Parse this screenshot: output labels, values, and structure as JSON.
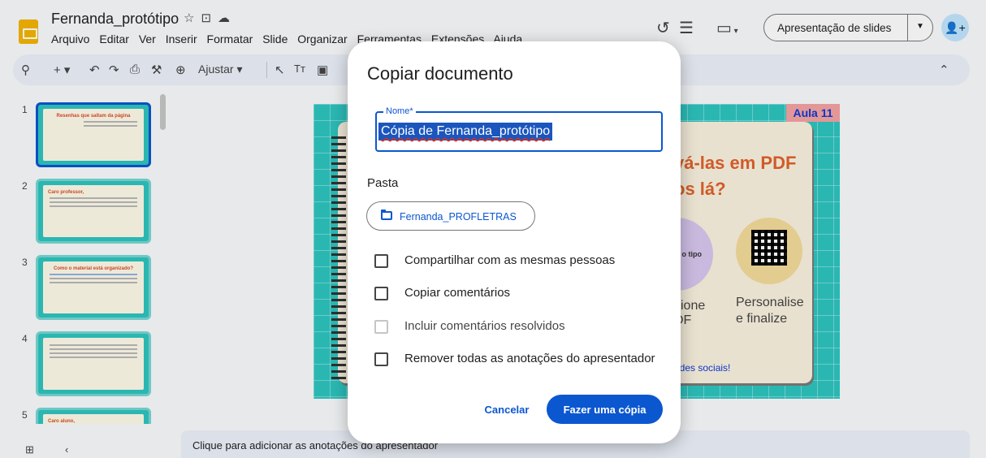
{
  "app": {
    "doc_title": "Fernanda_protótipo",
    "title_icons": [
      "star-icon",
      "move-to-folder-icon",
      "cloud-saved-icon"
    ],
    "menu": [
      "Arquivo",
      "Editar",
      "Ver",
      "Inserir",
      "Formatar",
      "Slide",
      "Organizar",
      "Ferramentas",
      "Extensões",
      "Ajuda"
    ],
    "present_label": "Apresentação de slides",
    "header_icons": [
      "history-icon",
      "comments-icon",
      "meet-icon",
      "share-icon"
    ]
  },
  "toolbar": {
    "zoom_label": "Ajustar",
    "icons": [
      "search-icon",
      "new-slide-icon",
      "undo-icon",
      "redo-icon",
      "print-icon",
      "paint-format-icon",
      "zoom-icon",
      "select-icon",
      "textbox-icon",
      "image-icon",
      "collapse-icon"
    ]
  },
  "thumbnails": [
    {
      "num": "1",
      "title": "Resenhas que saltam da página"
    },
    {
      "num": "2",
      "title": "Caro professor,"
    },
    {
      "num": "3",
      "title": "Como o material está organizado?"
    },
    {
      "num": "4",
      "title": ""
    },
    {
      "num": "5",
      "title": "Caro aluno,"
    }
  ],
  "slide": {
    "badge": "Aula 11",
    "heading1": "vá-las em PDF",
    "heading2": "os lá?",
    "circle_label": "a o tipo",
    "text_left1": "cione",
    "text_left2": "DF",
    "text_right1": "Personalise",
    "text_right2": "e finalize",
    "link_text": "edes sociais!"
  },
  "notes_placeholder": "Clique para adicionar as anotações do apresentador",
  "dialog": {
    "title": "Copiar documento",
    "name_label": "Nome*",
    "name_value": "Cópia de Fernanda_protótipo",
    "folder_label": "Pasta",
    "folder_name": "Fernanda_PROFLETRAS",
    "options": [
      {
        "label": "Compartilhar com as mesmas pessoas",
        "checked": false,
        "disabled": false
      },
      {
        "label": "Copiar comentários",
        "checked": false,
        "disabled": false
      },
      {
        "label": "Incluir comentários resolvidos",
        "checked": false,
        "disabled": true
      },
      {
        "label": "Remover todas as anotações do apresentador",
        "checked": false,
        "disabled": false
      }
    ],
    "cancel_label": "Cancelar",
    "confirm_label": "Fazer uma cópia"
  },
  "colors": {
    "accent": "#0b57d0",
    "slide_bg": "#2ec5c0",
    "logo": "#f4b400"
  }
}
